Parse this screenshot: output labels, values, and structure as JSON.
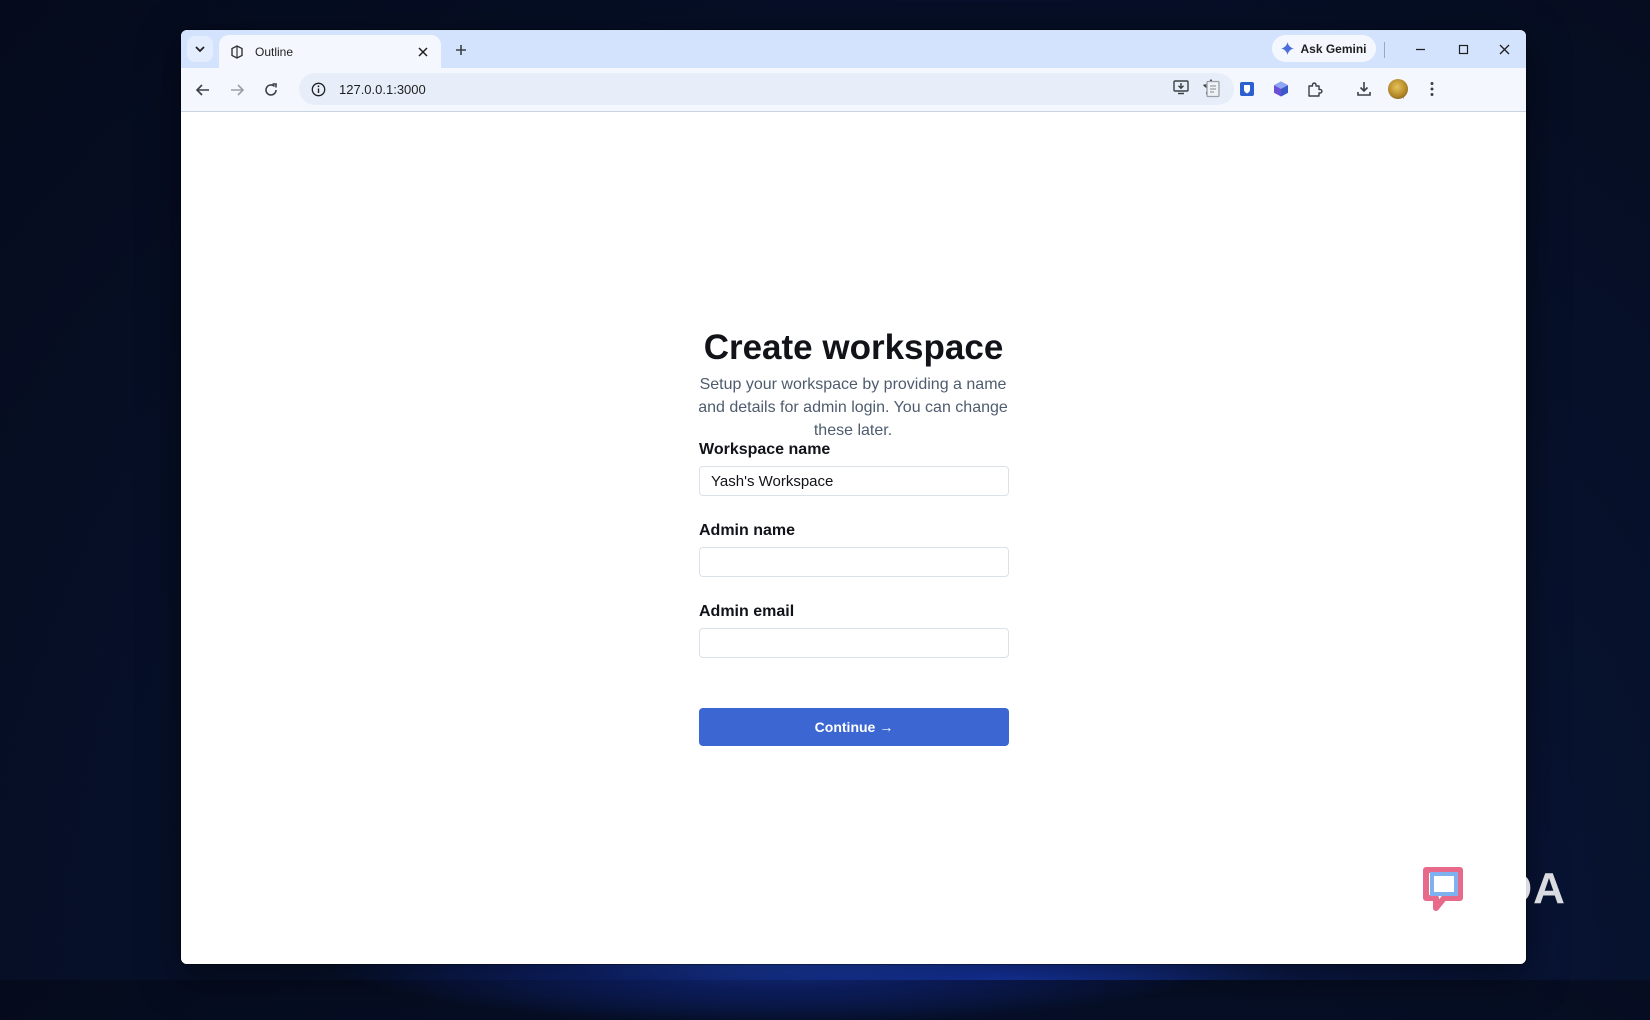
{
  "browser": {
    "tab_title": "Outline",
    "url": "127.0.0.1:3000",
    "gemini_label": "Ask Gemini"
  },
  "page": {
    "title": "Create workspace",
    "subtitle": "Setup your workspace by providing a name and details for admin login. You can change these later.",
    "fields": [
      {
        "label": "Workspace name",
        "value": "Yash's Workspace"
      },
      {
        "label": "Admin name",
        "value": ""
      },
      {
        "label": "Admin email",
        "value": ""
      }
    ],
    "continue_label": "Continue",
    "continue_arrow": "→"
  },
  "watermark": {
    "text": "XDA"
  },
  "colors": {
    "accent": "#3c66d2",
    "tabstrip": "#d3e3fd",
    "toolbar": "#f4f8fe"
  }
}
